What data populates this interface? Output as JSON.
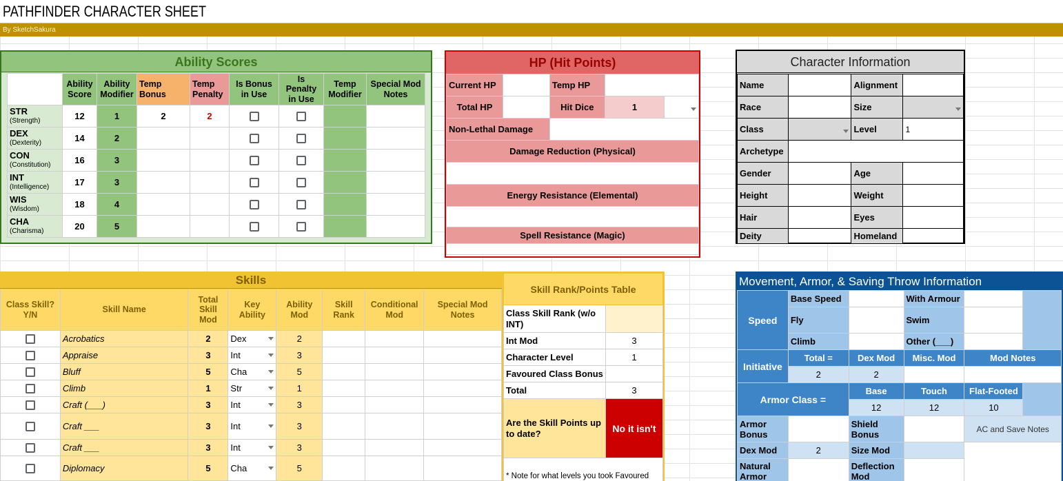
{
  "title": "PATHFINDER CHARACTER SHEET",
  "byline": "By SketchSakura",
  "ability": {
    "title": "Ability Scores",
    "headers": [
      "Ability Score",
      "Ability Modifier",
      "Temp Bonus",
      "Temp Penalty",
      "Is Bonus in Use",
      "Is Penalty in Use",
      "Temp Modifier",
      "Special Mod Notes"
    ],
    "rows": [
      {
        "abbr": "STR",
        "name": "(Strength)",
        "score": "12",
        "mod": "1",
        "bonus": "2",
        "penalty": "2"
      },
      {
        "abbr": "DEX",
        "name": "(Dexterity)",
        "score": "14",
        "mod": "2",
        "bonus": "",
        "penalty": ""
      },
      {
        "abbr": "CON",
        "name": "(Constitution)",
        "score": "16",
        "mod": "3",
        "bonus": "",
        "penalty": ""
      },
      {
        "abbr": "INT",
        "name": "(Intelligence)",
        "score": "17",
        "mod": "3",
        "bonus": "",
        "penalty": ""
      },
      {
        "abbr": "WIS",
        "name": "(Wisdom)",
        "score": "18",
        "mod": "4",
        "bonus": "",
        "penalty": ""
      },
      {
        "abbr": "CHA",
        "name": "(Charisma)",
        "score": "20",
        "mod": "5",
        "bonus": "",
        "penalty": ""
      }
    ]
  },
  "hp": {
    "title": "HP (Hit Points)",
    "current": "Current HP",
    "temp": "Temp HP",
    "total": "Total HP",
    "hitdice": "Hit Dice",
    "hitdice_value": "1",
    "nonlethal": "Non-Lethal Damage",
    "dr": "Damage Reduction (Physical)",
    "er": "Energy Resistance (Elemental)",
    "sr": "Spell Resistance (Magic)"
  },
  "charinfo": {
    "title": "Character Information",
    "name": "Name",
    "alignment": "Alignment",
    "race": "Race",
    "size": "Size",
    "class": "Class",
    "level": "Level",
    "level_value": "1",
    "archetype": "Archetype",
    "gender": "Gender",
    "age": "Age",
    "height": "Height",
    "weight": "Weight",
    "hair": "Hair",
    "eyes": "Eyes",
    "deity": "Deity",
    "homeland": "Homeland"
  },
  "skills": {
    "title": "Skills",
    "headers": [
      "Class Skill? Y/N",
      "Skill Name",
      "Total Skill Mod",
      "Key Ability",
      "Ability Mod",
      "Skill Rank",
      "Conditional Mod",
      "Special Mod Notes"
    ],
    "rows": [
      {
        "name": "Acrobatics",
        "total": "2",
        "key": "Dex",
        "mod": "2"
      },
      {
        "name": "Appraise",
        "total": "3",
        "key": "Int",
        "mod": "3"
      },
      {
        "name": "Bluff",
        "total": "5",
        "key": "Cha",
        "mod": "5"
      },
      {
        "name": "Climb",
        "total": "1",
        "key": "Str",
        "mod": "1"
      },
      {
        "name": "Craft (___)",
        "total": "3",
        "key": "Int",
        "mod": "3"
      },
      {
        "name": "Craft ___",
        "total": "3",
        "key": "Int",
        "mod": "3"
      },
      {
        "name": "Craft ___",
        "total": "3",
        "key": "Int",
        "mod": "3"
      },
      {
        "name": "Diplomacy",
        "total": "5",
        "key": "Cha",
        "mod": "5"
      }
    ]
  },
  "skillrank": {
    "title": "Skill Rank/Points Table",
    "class_rank": "Class Skill Rank (w/o INT)",
    "int_mod": "Int Mod",
    "int_mod_value": "3",
    "char_level": "Character Level",
    "char_level_value": "1",
    "fav": "Favoured Class Bonus",
    "total": "Total",
    "total_value": "3",
    "uptodate": "Are the Skill Points up to date?",
    "uptodate_value": "No it isn't",
    "note": "* Note for what levels you took Favoured"
  },
  "movement": {
    "title": "Movement, Armor, & Saving Throw Information",
    "speed": "Speed",
    "base_speed": "Base Speed",
    "with_armour": "With Armour",
    "fly": "Fly",
    "swim": "Swim",
    "climb": "Climb",
    "other": "Other (___)",
    "initiative": "Initiative",
    "init_total": "Total =",
    "init_dex": "Dex Mod",
    "init_misc": "Misc. Mod",
    "init_notes": "Mod Notes",
    "init_total_value": "2",
    "init_dex_value": "2",
    "armor_class": "Armor Class =",
    "ac_base": "Base",
    "ac_touch": "Touch",
    "ac_flat": "Flat-Footed",
    "ac_base_value": "12",
    "ac_touch_value": "12",
    "ac_flat_value": "10",
    "armor_bonus": "Armor Bonus",
    "shield_bonus": "Shield Bonus",
    "ac_notes": "AC and Save Notes",
    "dex_mod": "Dex Mod",
    "dex_mod_value": "2",
    "size_mod": "Size Mod",
    "natural_armor": "Natural Armor",
    "deflection_mod": "Deflection Mod"
  }
}
